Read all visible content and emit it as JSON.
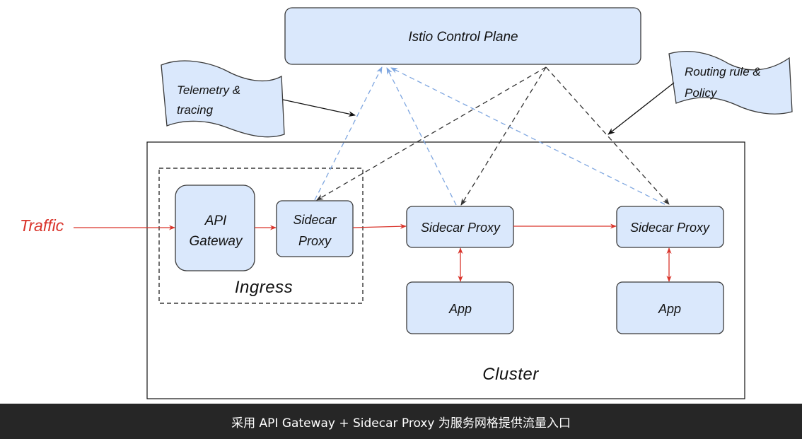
{
  "diagram": {
    "control_plane": {
      "label": "Istio Control Plane"
    },
    "telemetry_note": {
      "lines": [
        "Telemetry &",
        "tracing"
      ]
    },
    "routing_note": {
      "lines": [
        "Routing rule &",
        "Policy"
      ]
    },
    "traffic": {
      "label": "Traffic"
    },
    "cluster": {
      "label": "Cluster"
    },
    "ingress": {
      "label": "Ingress",
      "api_gateway": {
        "lines": [
          "API",
          "Gateway"
        ]
      },
      "sidecar": {
        "lines": [
          "Sidecar",
          "Proxy"
        ]
      }
    },
    "services": [
      {
        "sidecar": "Sidecar Proxy",
        "app": "App"
      },
      {
        "sidecar": "Sidecar Proxy",
        "app": "App"
      }
    ]
  },
  "caption": "采用 API Gateway + Sidecar Proxy 为服务网格提供流量入口",
  "colors": {
    "box_fill": "#dae8fc",
    "box_border": "#3a3a3a",
    "traffic": "#d9342b",
    "telemetry": "#7ea6e0",
    "control": "#333333",
    "caption_bg": "#262626",
    "caption_text": "#ffffff"
  }
}
